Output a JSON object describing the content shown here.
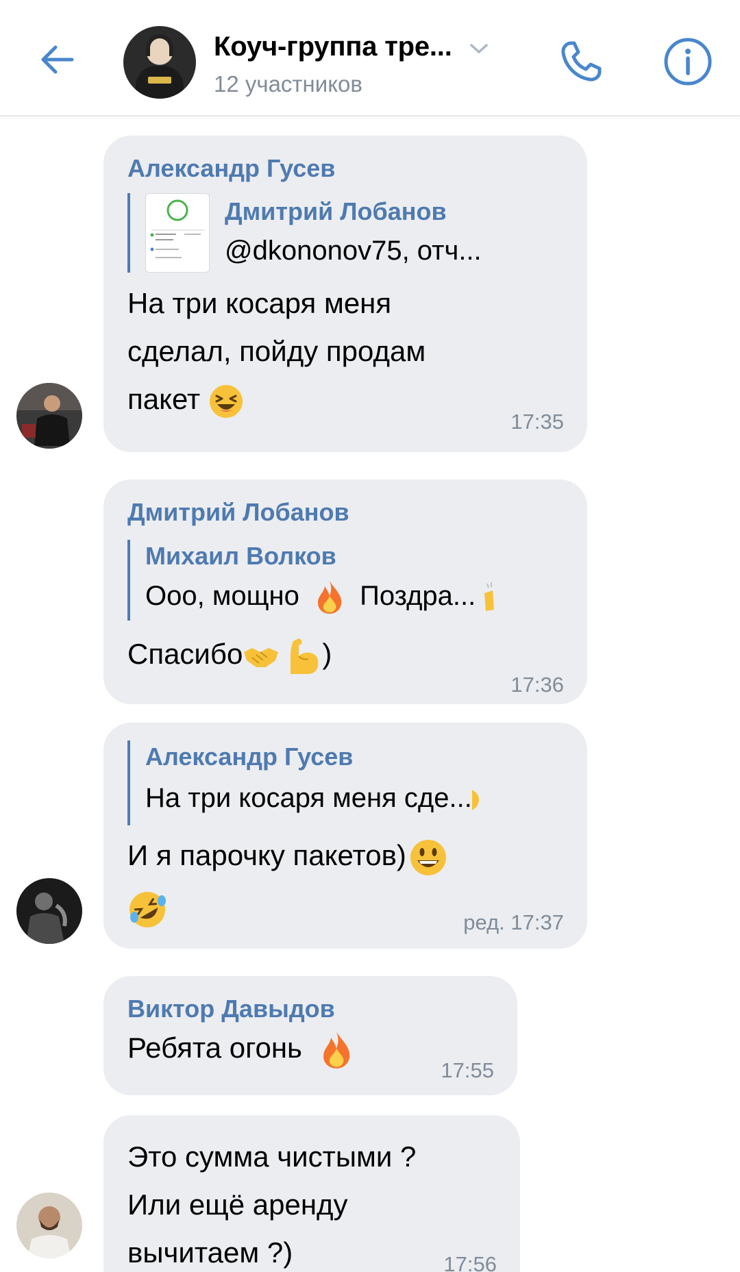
{
  "header": {
    "title": "Коуч-группа тре...",
    "subtitle": "12 участников"
  },
  "colors": {
    "accent": "#4f7ab0",
    "icon_blue": "#4a86cc",
    "bubble_bg": "#ebedf0",
    "meta_gray": "#818c99"
  },
  "messages": [
    {
      "sender": "Александр Гусев",
      "reply": {
        "name": "Дмитрий Лобанов",
        "text": "@dkononov75, отч...",
        "has_thumbnail": true
      },
      "lines": [
        "На три косаря меня",
        "сделал, пойду продам",
        "пакет"
      ],
      "emoji": "laughing-emoji",
      "time": "17:35"
    },
    {
      "sender": "Дмитрий Лобанов",
      "reply": {
        "name": "Михаил Волков",
        "text": "Ооо, мощно",
        "text2": "Поздра..."
      },
      "lines": [
        "Спасибо",
        ")"
      ],
      "emoji": "handshake-emoji, flexed-biceps-emoji",
      "time": "17:36"
    },
    {
      "sender": "",
      "reply": {
        "name": "Александр Гусев",
        "text": "На три косаря меня сде..."
      },
      "lines": [
        "И я парочку пакетов)"
      ],
      "emoji": "grinning-emoji, rofl-emoji",
      "time": "ред. 17:37"
    },
    {
      "sender": "Виктор Давыдов",
      "lines": [
        "Ребята огонь"
      ],
      "emoji": "fire-emoji",
      "time": "17:55"
    },
    {
      "sender": "",
      "lines": [
        "Это сумма чистыми ?",
        "Или ещё аренду",
        "вычитаем ?)"
      ],
      "time": "17:56"
    }
  ]
}
